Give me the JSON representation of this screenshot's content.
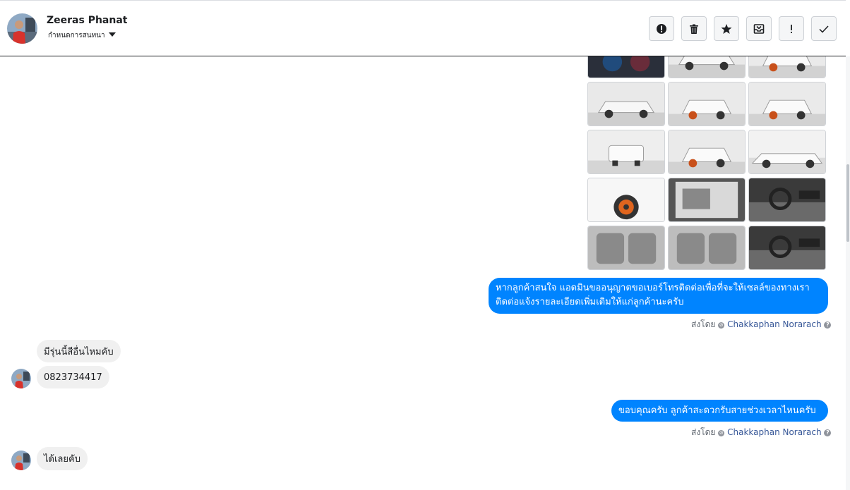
{
  "header": {
    "contact_name": "Zeeras Phanat",
    "assign_label": "กำหนดการสนทนา",
    "actions": [
      {
        "name": "mark-spam-button",
        "icon": "alert-circle-icon"
      },
      {
        "name": "delete-button",
        "icon": "trash-icon"
      },
      {
        "name": "star-button",
        "icon": "star-icon"
      },
      {
        "name": "archive-button",
        "icon": "archive-icon"
      },
      {
        "name": "follow-up-button",
        "icon": "exclamation-icon"
      },
      {
        "name": "done-button",
        "icon": "check-icon"
      }
    ]
  },
  "thread": {
    "photo_grid": {
      "rows": 5,
      "cols": 3,
      "items": [
        "car-photo",
        "car-photo",
        "car-photo",
        "car-photo",
        "car-photo",
        "car-photo",
        "car-photo",
        "car-photo",
        "car-photo",
        "car-photo",
        "car-photo",
        "car-photo",
        "car-photo",
        "car-photo",
        "car-photo"
      ]
    },
    "messages": [
      {
        "direction": "out",
        "lines": [
          "หากลูกค้าสนใจ แอดมินขออนุญาตขอเบอร์โทรติดต่อเพื่อที่จะให้เซลล์ของทางเรา",
          "ติดต่อแจ้งรายละเอียดเพิ่มเติมให้แก่ลูกค้านะครับ"
        ]
      },
      {
        "direction": "in",
        "text": "มีรุ่นนี้สีอื่นไหมคับ"
      },
      {
        "direction": "in",
        "text": "0823734417"
      },
      {
        "direction": "out",
        "text": "ขอบคุณครับ ลูกค้าสะดวกรับสายช่วงเวลาไหนครับ"
      },
      {
        "direction": "in",
        "text": "ได้เลยคับ"
      }
    ],
    "sent_by": {
      "prefix": "ส่งโดย",
      "name": "Chakkaphan Norarach"
    }
  },
  "colors": {
    "accent": "#0084ff",
    "incoming_bg": "#f0f0f0",
    "link": "#385898"
  }
}
